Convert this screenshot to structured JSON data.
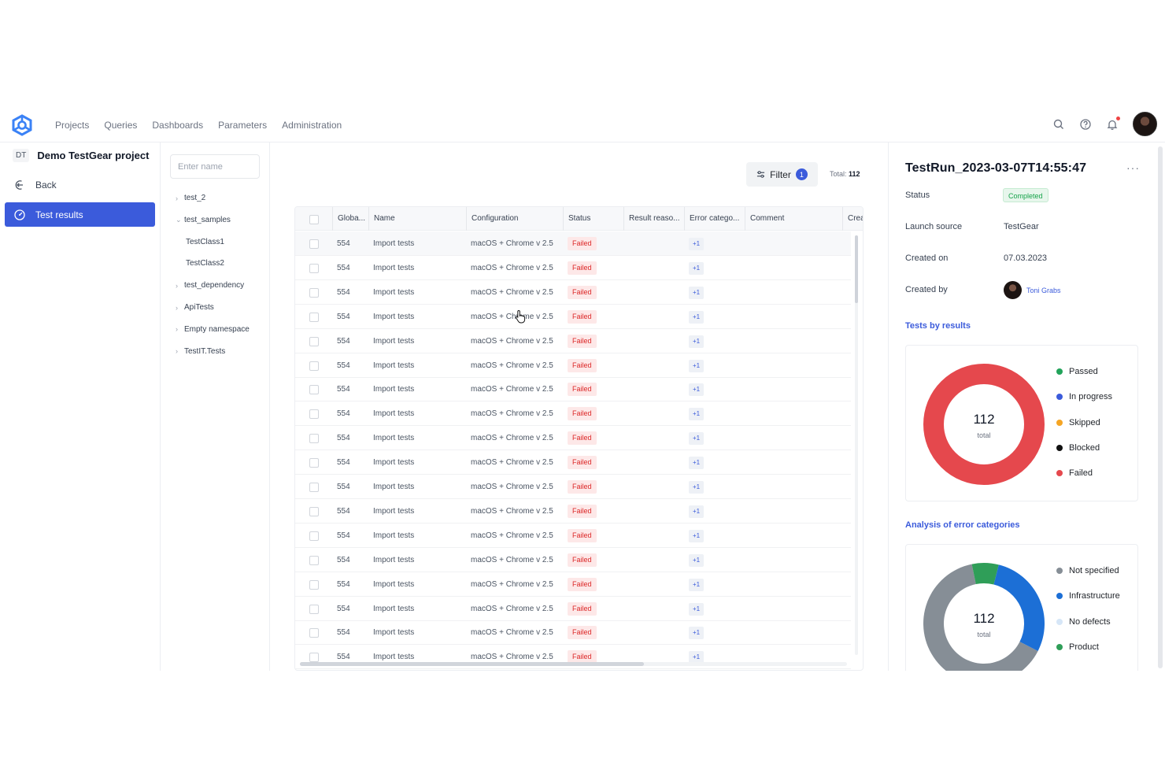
{
  "nav": {
    "links": [
      "Projects",
      "Queries",
      "Dashboards",
      "Parameters",
      "Administration"
    ]
  },
  "sidebar": {
    "project_badge": "DT",
    "project_title": "Demo TestGear project",
    "back_label": "Back",
    "active_label": "Test results"
  },
  "tree": {
    "search_placeholder": "Enter name",
    "items": [
      {
        "label": "test_2",
        "chevron": "›",
        "indent": 0
      },
      {
        "label": "test_samples",
        "chevron": "⌄",
        "indent": 0
      },
      {
        "label": "TestClass1",
        "chevron": "",
        "indent": 1
      },
      {
        "label": "TestClass2",
        "chevron": "",
        "indent": 1
      },
      {
        "label": "test_dependency",
        "chevron": "›",
        "indent": 0
      },
      {
        "label": "ApiTests",
        "chevron": "›",
        "indent": 0
      },
      {
        "label": "Empty namespace",
        "chevron": "›",
        "indent": 0
      },
      {
        "label": "TestIT.Tests",
        "chevron": "›",
        "indent": 0
      }
    ]
  },
  "toolbar": {
    "filter_label": "Filter",
    "filter_count": "1",
    "total_label": "Total:",
    "total_value": "112"
  },
  "table": {
    "columns": [
      "Globa...",
      "Name",
      "Configuration",
      "Status",
      "Result reaso...",
      "Error catego...",
      "Comment",
      "Crea"
    ],
    "rows": [
      {
        "id": "554",
        "name": "Import tests",
        "config": "macOS + Chrome v 2.5",
        "status": "Failed",
        "error": "+1"
      },
      {
        "id": "554",
        "name": "Import tests",
        "config": "macOS + Chrome v 2.5",
        "status": "Failed",
        "error": "+1"
      },
      {
        "id": "554",
        "name": "Import tests",
        "config": "macOS + Chrome v 2.5",
        "status": "Failed",
        "error": "+1"
      },
      {
        "id": "554",
        "name": "Import tests",
        "config": "macOS + Chrome v 2.5",
        "status": "Failed",
        "error": "+1"
      },
      {
        "id": "554",
        "name": "Import tests",
        "config": "macOS + Chrome v 2.5",
        "status": "Failed",
        "error": "+1"
      },
      {
        "id": "554",
        "name": "Import tests",
        "config": "macOS + Chrome v 2.5",
        "status": "Failed",
        "error": "+1"
      },
      {
        "id": "554",
        "name": "Import tests",
        "config": "macOS + Chrome v 2.5",
        "status": "Failed",
        "error": "+1"
      },
      {
        "id": "554",
        "name": "Import tests",
        "config": "macOS + Chrome v 2.5",
        "status": "Failed",
        "error": "+1"
      },
      {
        "id": "554",
        "name": "Import tests",
        "config": "macOS + Chrome v 2.5",
        "status": "Failed",
        "error": "+1"
      },
      {
        "id": "554",
        "name": "Import tests",
        "config": "macOS + Chrome v 2.5",
        "status": "Failed",
        "error": "+1"
      },
      {
        "id": "554",
        "name": "Import tests",
        "config": "macOS + Chrome v 2.5",
        "status": "Failed",
        "error": "+1"
      },
      {
        "id": "554",
        "name": "Import tests",
        "config": "macOS + Chrome v 2.5",
        "status": "Failed",
        "error": "+1"
      },
      {
        "id": "554",
        "name": "Import tests",
        "config": "macOS + Chrome v 2.5",
        "status": "Failed",
        "error": "+1"
      },
      {
        "id": "554",
        "name": "Import tests",
        "config": "macOS + Chrome v 2.5",
        "status": "Failed",
        "error": "+1"
      },
      {
        "id": "554",
        "name": "Import tests",
        "config": "macOS + Chrome v 2.5",
        "status": "Failed",
        "error": "+1"
      },
      {
        "id": "554",
        "name": "Import tests",
        "config": "macOS + Chrome v 2.5",
        "status": "Failed",
        "error": "+1"
      },
      {
        "id": "554",
        "name": "Import tests",
        "config": "macOS + Chrome v 2.5",
        "status": "Failed",
        "error": "+1"
      },
      {
        "id": "554",
        "name": "Import tests",
        "config": "macOS + Chrome v 2.5",
        "status": "Failed",
        "error": "+1"
      }
    ]
  },
  "run": {
    "title": "TestRun_2023-03-07T14:55:47",
    "more": "···",
    "status_label": "Status",
    "status_value": "Completed",
    "launch_label": "Launch source",
    "launch_value": "TestGear",
    "created_on_label": "Created on",
    "created_on_value": "07.03.2023",
    "created_by_label": "Created by",
    "created_by_value": "Toni Grabs"
  },
  "charts": {
    "results": {
      "title": "Tests by results",
      "total": "112",
      "total_label": "total",
      "legend": [
        {
          "name": "Passed",
          "color": "#22a35a"
        },
        {
          "name": "In progress",
          "color": "#3b5bdb"
        },
        {
          "name": "Skipped",
          "color": "#f5a524"
        },
        {
          "name": "Blocked",
          "color": "#111111"
        },
        {
          "name": "Failed",
          "color": "#e5484d"
        }
      ]
    },
    "errors": {
      "title": "Analysis of error categories",
      "total": "112",
      "total_label": "total",
      "legend": [
        {
          "name": "Not specified",
          "color": "#868e96"
        },
        {
          "name": "Infrastructure",
          "color": "#1c6fd6"
        },
        {
          "name": "No defects",
          "color": "#d6e6f7"
        },
        {
          "name": "Product",
          "color": "#2f9e58"
        }
      ]
    }
  },
  "chart_data": [
    {
      "type": "pie",
      "title": "Tests by results",
      "categories": [
        "Passed",
        "In progress",
        "Skipped",
        "Blocked",
        "Failed"
      ],
      "values": [
        0,
        0,
        0,
        0,
        112
      ]
    },
    {
      "type": "pie",
      "title": "Analysis of error categories",
      "categories": [
        "Not specified",
        "Product",
        "Infrastructure"
      ],
      "values": [
        72,
        8,
        32
      ]
    }
  ]
}
